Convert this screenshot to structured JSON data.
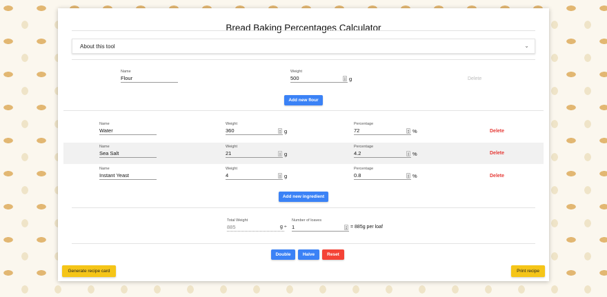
{
  "app": {
    "title": "Bread Baking Percentages Calculator"
  },
  "about": {
    "label": "About this tool"
  },
  "flour": {
    "name_label": "Name",
    "name_value": "Flour",
    "weight_label": "Weight",
    "weight_value": "500",
    "weight_unit": "g",
    "delete_label": "Delete"
  },
  "add_flour_label": "Add new flour",
  "ingredients": [
    {
      "name_label": "Name",
      "name": "Water",
      "weight_label": "Weight",
      "weight": "360",
      "weight_unit": "g",
      "percentage_label": "Percentage",
      "percentage": "72",
      "percentage_unit": "%",
      "delete_label": "Delete"
    },
    {
      "name_label": "Name",
      "name": "Sea Salt",
      "weight_label": "Weight",
      "weight": "21",
      "weight_unit": "g",
      "percentage_label": "Percentage",
      "percentage": "4.2",
      "percentage_unit": "%",
      "delete_label": "Delete"
    },
    {
      "name_label": "Name",
      "name": "Instant Yeast",
      "weight_label": "Weight",
      "weight": "4",
      "weight_unit": "g",
      "percentage_label": "Percentage",
      "percentage": "0.8",
      "percentage_unit": "%",
      "delete_label": "Delete"
    }
  ],
  "add_ingredient_label": "Add new ingredient",
  "summary": {
    "total_weight_label": "Total Weight",
    "total_weight": "885",
    "divider_text": "g ÷",
    "loaves_label": "Number of loaves",
    "loaves": "1",
    "result_text": "= 885g per loaf"
  },
  "actions": {
    "double": "Double",
    "halve": "Halve",
    "reset": "Reset"
  },
  "footer": {
    "recipe_card": "Generate recipe card",
    "print": "Print recipe"
  },
  "colors": {
    "primary": "#3b82f6",
    "danger": "#f44336",
    "accent": "#f5c518"
  }
}
